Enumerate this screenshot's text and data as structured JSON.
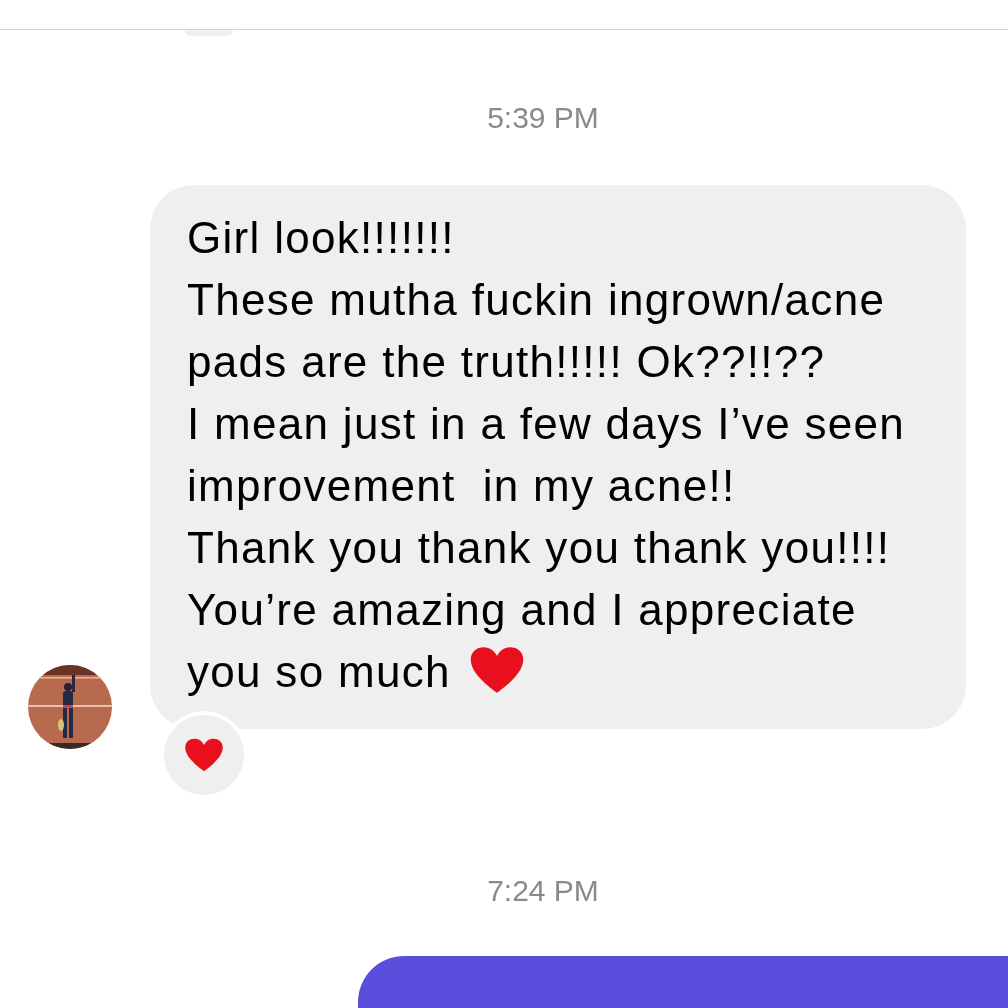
{
  "messages": [
    {
      "kind": "timestamp",
      "text": "5:39 PM"
    },
    {
      "kind": "incoming",
      "paragraphs": [
        "Girl look!!!!!!!",
        "These mutha fuckin ingrown/acne pads are the truth!!!!! Ok??!!??",
        "I mean just in a few days I’ve seen improvement  in my acne!!",
        "Thank you thank you thank you!!!!",
        "You’re amazing and I appreciate you so much"
      ],
      "ends_with_heart": true,
      "reacted": true
    },
    {
      "kind": "timestamp",
      "text": "7:24 PM"
    },
    {
      "kind": "outgoing"
    }
  ]
}
